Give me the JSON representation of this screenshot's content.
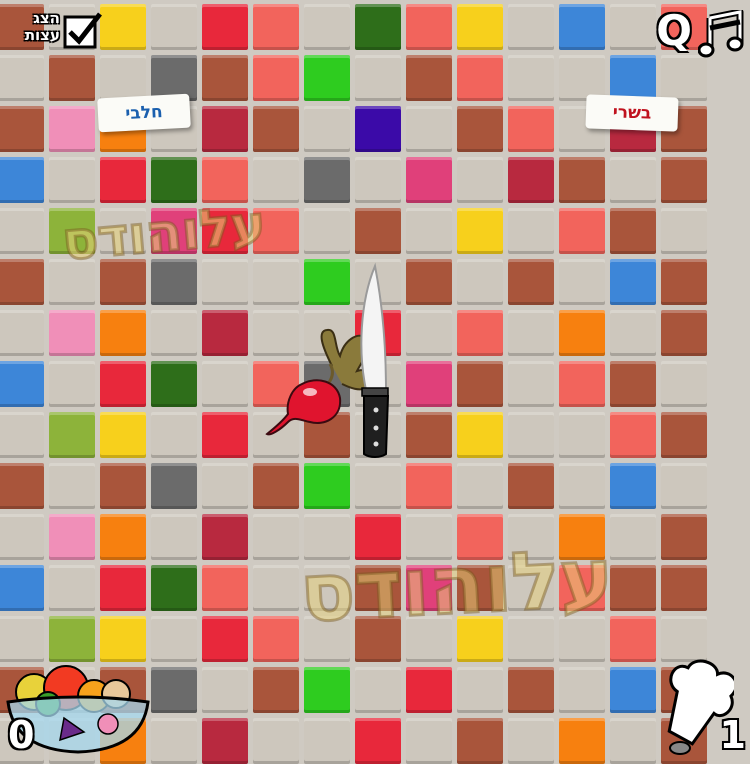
{
  "hud": {
    "tips_label_line1": "הצג",
    "tips_label_line2": "עצות",
    "tips_checked": true,
    "quality_label": "Q",
    "music_icon": "music-note-icon"
  },
  "signs": {
    "dairy_label": "חלבי",
    "meat_label": "בשרי"
  },
  "item": {
    "name": "radish-icon"
  },
  "watermark": {
    "text": "עלוהודס"
  },
  "scores": {
    "left": "0",
    "right": "1"
  },
  "colors": {
    "grey": "#cdc7bd",
    "brown": "#a9553b",
    "red": "#e8283b",
    "salmon": "#f2645c",
    "yellow": "#f7d01c",
    "green": "#2ecc1f",
    "darkgreen": "#2e6e1a",
    "blue": "#3d86d8",
    "pink": "#f08fb8",
    "orange": "#f7800f",
    "darkgrey": "#6b6b6b",
    "olive": "#8db33a",
    "maroon": "#b8293f",
    "magenta": "#e0407a",
    "purple": "#3b0aa8",
    "dkbrown": "#7a5034"
  }
}
